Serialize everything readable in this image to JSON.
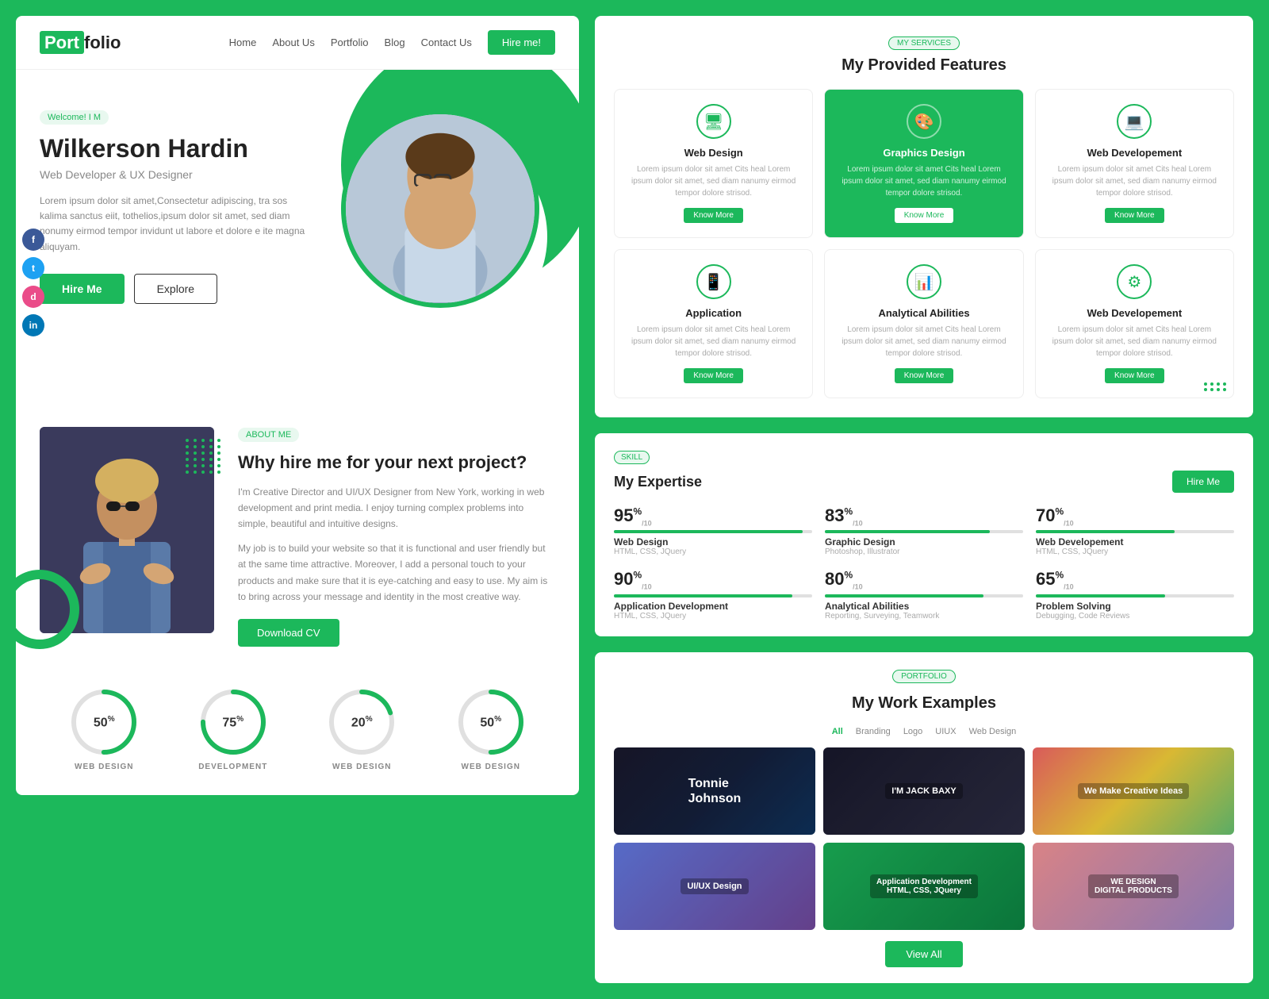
{
  "nav": {
    "logo_port": "Port",
    "logo_folio": "folio",
    "links": [
      "Home",
      "About Us",
      "Portfolio",
      "Blog",
      "Contact Us"
    ],
    "hire_btn": "Hire me!"
  },
  "hero": {
    "welcome_badge": "Welcome! I M",
    "name": "Wilkerson Hardin",
    "title": "Web Developer & UX Designer",
    "description": "Lorem ipsum dolor sit amet,Consectetur adipiscing, tra sos kalima sanctus eiit, tothelios,ipsum dolor sit amet, sed diam nonumy eirmod tempor invidunt ut labore et dolore e ite magna aliquyam.",
    "btn_hire": "Hire Me",
    "btn_explore": "Explore"
  },
  "social": [
    "f",
    "t",
    "d",
    "in"
  ],
  "about": {
    "badge": "ABOUT ME",
    "heading": "Why hire me for your next project?",
    "text1": "I'm Creative Director and UI/UX Designer from New York, working in web development and print media. I enjoy turning complex problems into simple, beautiful and intuitive designs.",
    "text2": "My job is to build your website so that it is functional and user friendly but at the same time attractive. Moreover, I add a personal touch to your products and make sure that it is eye-catching and easy to use. My aim is to bring across your message and identity in the most creative way.",
    "btn_cv": "Download CV"
  },
  "stats": [
    {
      "percent": "50",
      "label": "WEB DESIGN",
      "value": 50
    },
    {
      "percent": "75",
      "label": "DEVELOPMENT",
      "value": 75
    },
    {
      "percent": "20",
      "label": "WEB DESIGN",
      "value": 20
    },
    {
      "percent": "50",
      "label": "WEB DESIGN",
      "value": 50
    }
  ],
  "services": {
    "badge": "MY SERVICES",
    "title": "My Provided Features",
    "cards": [
      {
        "icon": "🖥",
        "name": "Web Design",
        "desc": "Lorem ipsum dolor sit amet Cits heal Lorem ipsum dolor sit amet, sed diam nanumy eirmod tempor dolore strisod.",
        "btn": "Know More",
        "featured": false
      },
      {
        "icon": "🎨",
        "name": "Graphics Design",
        "desc": "Lorem ipsum dolor sit amet Cits heal Lorem ipsum dolor sit amet, sed diam nanumy eirmod tempor dolore strisod.",
        "btn": "Know More",
        "featured": true
      },
      {
        "icon": "💻",
        "name": "Web Developement",
        "desc": "Lorem ipsum dolor sit amet Cits heal Lorem ipsum dolor sit amet, sed diam nanumy eirmod tempor dolore strisod.",
        "btn": "Know More",
        "featured": false
      },
      {
        "icon": "📱",
        "name": "Application",
        "desc": "Lorem ipsum dolor sit amet Cits heal Lorem ipsum dolor sit amet, sed diam nanumy eirmod tempor dolore strisod.",
        "btn": "Know More",
        "featured": false
      },
      {
        "icon": "📊",
        "name": "Analytical Abilities",
        "desc": "Lorem ipsum dolor sit amet Cits heal Lorem ipsum dolor sit amet, sed diam nanumy eirmod tempor dolore strisod.",
        "btn": "Know More",
        "featured": false
      },
      {
        "icon": "⚙",
        "name": "Web Developement",
        "desc": "Lorem ipsum dolor sit amet Cits heal Lorem ipsum dolor sit amet, sed diam nanumy eirmod tempor dolore strisod.",
        "btn": "Know More",
        "featured": false
      }
    ]
  },
  "expertise": {
    "badge": "SKILL",
    "title": "My Expertise",
    "hire_btn": "Hire Me",
    "skills": [
      {
        "percent": 95,
        "name": "Web Design",
        "sub": "HTML, CSS, JQuery"
      },
      {
        "percent": 83,
        "name": "Graphic Design",
        "sub": "Photoshop, Illustrator"
      },
      {
        "percent": 70,
        "name": "Web Developement",
        "sub": "HTML, CSS, JQuery"
      },
      {
        "percent": 90,
        "name": "Application Development",
        "sub": "HTML, CSS, JQuery"
      },
      {
        "percent": 80,
        "name": "Analytical Abilities",
        "sub": "Reporting, Surveying, Teamwork"
      },
      {
        "percent": 65,
        "name": "Problem Solving",
        "sub": "Debugging, Code Reviews"
      }
    ]
  },
  "portfolio": {
    "badge": "PORTFOLIO",
    "title": "My Work Examples",
    "filters": [
      "All",
      "Branding",
      "Logo",
      "UIUX",
      "Web Design"
    ],
    "items": [
      {
        "label": "Tonnie\nJohnson",
        "type": "name"
      },
      {
        "label": "I'M JACK BAXY",
        "type": "label"
      },
      {
        "label": "We Make Creative Ideas",
        "type": "label"
      },
      {
        "label": "",
        "type": "image"
      },
      {
        "label": "Application Development\nHTML, CSS, JQuery",
        "type": "label"
      },
      {
        "label": "WE DESIGN DIGITAL PRODUCTS",
        "type": "label"
      }
    ],
    "view_all_btn": "View All"
  }
}
